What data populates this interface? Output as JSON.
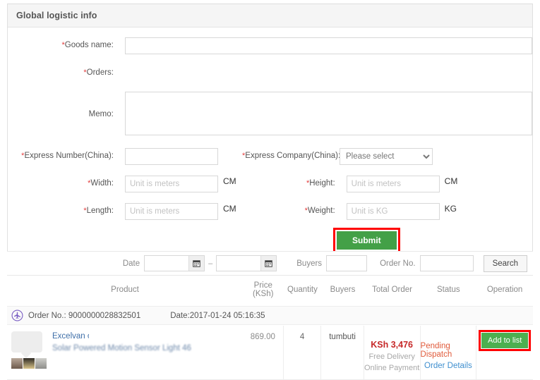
{
  "panel": {
    "title": "Global logistic info"
  },
  "form": {
    "goods_name": {
      "label": "Goods name:",
      "required": true,
      "value": "",
      "placeholder": ""
    },
    "orders": {
      "label": "Orders:",
      "required": true,
      "value": ""
    },
    "memo": {
      "label": "Memo:",
      "required": false,
      "value": "",
      "placeholder": ""
    },
    "express_number": {
      "label": "Express Number(China):",
      "required": true,
      "value": "",
      "placeholder": ""
    },
    "express_company": {
      "label": "Express Company(China):",
      "required": true,
      "selected": "Please select"
    },
    "width": {
      "label": "Width:",
      "required": true,
      "placeholder": "Unit is meters",
      "unit": "CM",
      "value": ""
    },
    "height": {
      "label": "Height:",
      "required": true,
      "placeholder": "Unit is meters",
      "unit": "CM",
      "value": ""
    },
    "length": {
      "label": "Length:",
      "required": true,
      "placeholder": "Unit is meters",
      "unit": "CM",
      "value": ""
    },
    "weight": {
      "label": "Weight:",
      "required": true,
      "placeholder": "Unit is KG",
      "unit": "KG",
      "value": ""
    },
    "submit_label": "Submit",
    "submit_color": "#43a047",
    "highlight_color": "#ff0000"
  },
  "search": {
    "date_label": "Date",
    "date_from": "",
    "date_to": "",
    "date_separator": "–",
    "calendar_icon": "calendar-icon",
    "buyers_label": "Buyers",
    "buyers_value": "",
    "order_no_label": "Order No.",
    "order_no_value": "",
    "search_label": "Search"
  },
  "table": {
    "headers": [
      "Product",
      "Price (KSh)",
      "Quantity",
      "Buyers",
      "Total Order",
      "Status",
      "Operation"
    ],
    "order_group": {
      "icon": "airplane-circle-icon",
      "order_no_label": "Order No.: 9000000028832501",
      "date_label": "Date:2017-01-24 05:16:35"
    },
    "rows": [
      {
        "product_line1": "Excelvan                      oof Wireless",
        "product_line2": "Solar Powered Motion Sensor Light 46",
        "price": "869.00",
        "quantity": "4",
        "buyer": "tumbuti",
        "total_order": "KSh 3,476",
        "delivery": "Free Delivery",
        "payment": "Online Payment",
        "status": "Pending Dispatch",
        "order_details": "Order Details",
        "operation_label": "Add to list"
      }
    ]
  }
}
